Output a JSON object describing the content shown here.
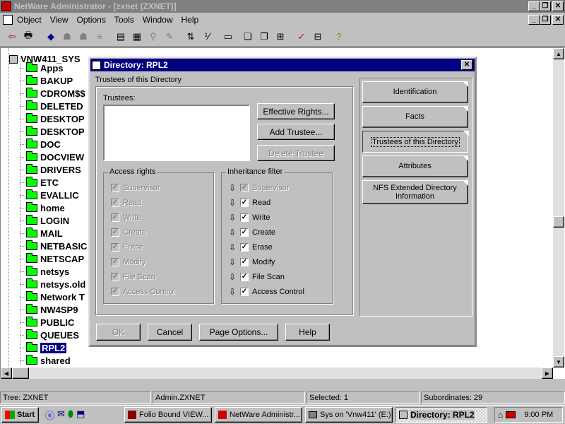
{
  "app": {
    "title": "NetWare Administrator - [zxnet (ZXNET)]",
    "menu": [
      "Object",
      "View",
      "Options",
      "Tools",
      "Window",
      "Help"
    ]
  },
  "tree": {
    "root": "VNW411_SYS",
    "items": [
      "Apps",
      "BAKUP",
      "CDROM$$",
      "DELETED",
      "DESKTOP",
      "DESKTOP",
      "DOC",
      "DOCVIEW",
      "DRIVERS",
      "ETC",
      "EVALLIC",
      "home",
      "LOGIN",
      "MAIL",
      "NETBASIC",
      "NETSCAP",
      "netsys",
      "netsys.old",
      "Network T",
      "NW4SP9",
      "PUBLIC",
      "QUEUES",
      "RPL2",
      "shared"
    ],
    "selected_index": 22
  },
  "dialog": {
    "title": "Directory: RPL2",
    "section_title": "Trustees of this Directory",
    "trustees_label": "Trustees:",
    "buttons": {
      "effective_rights": "Effective Rights...",
      "add_trustee": "Add Trustee...",
      "delete_trustee": "Delete Trustee"
    },
    "access_rights": {
      "label": "Access rights",
      "items": [
        "Supervisor",
        "Read",
        "Write",
        "Create",
        "Erase",
        "Modify",
        "File Scan",
        "Access Control"
      ]
    },
    "inheritance": {
      "label": "Inheritance filter",
      "items": [
        "Supervisor",
        "Read",
        "Write",
        "Create",
        "Erase",
        "Modify",
        "File Scan",
        "Access Control"
      ]
    },
    "pages": [
      "Identification",
      "Facts",
      "Trustees of this Directory",
      "Attributes",
      "NFS Extended Directory Information"
    ],
    "active_page": "Trustees of this Directory",
    "bottom_buttons": {
      "ok": "OK",
      "cancel": "Cancel",
      "page_options": "Page Options...",
      "help": "Help"
    }
  },
  "status": {
    "tree": "Tree: ZXNET",
    "user": "Admin.ZXNET",
    "selected": "Selected: 1",
    "subordinates": "Subordinates: 29"
  },
  "taskbar": {
    "start": "Start",
    "tasks": [
      "Folio Bound VIEW...",
      "NetWare Administr...",
      "Sys on 'Vnw411' (E:)",
      "Directory: RPL2"
    ],
    "clock": "9:00 PM"
  }
}
